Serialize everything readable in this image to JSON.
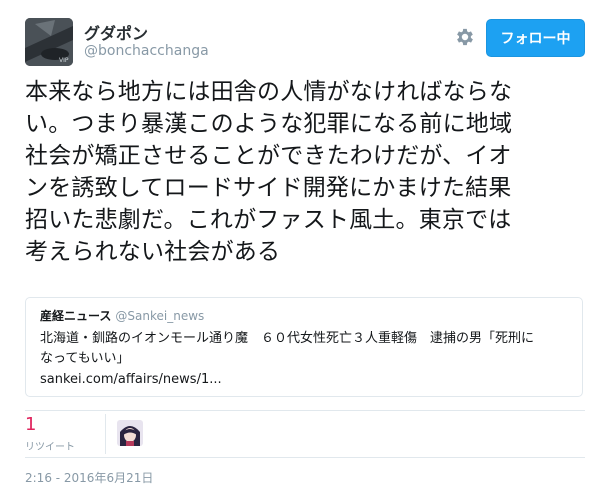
{
  "user": {
    "display_name": "グダポン",
    "screen_name": "@bonchacchanga",
    "avatar_icon": "profile-avatar-image"
  },
  "actions": {
    "gear_icon": "gear-icon",
    "follow_label": "フォロー中"
  },
  "tweet": {
    "lines": [
      "本来なら地方には田舎の人情がなければならな",
      "い。つまり暴漢このような犯罪になる前に地域",
      "社会が矯正させることができたわけだが、イオ",
      "ンを誘致してロードサイド開発にかまけた結果",
      "招いた悲劇だ。これがファスト風土。東京では",
      "考えられない社会がある"
    ]
  },
  "quote": {
    "name": "産経ニュース",
    "handle": "@Sankei_news",
    "lines": [
      "北海道・釧路のイオンモール通り魔　６０代女性死亡３人重軽傷　逮捕の男「死刑に",
      "なってもいい」"
    ],
    "url": "sankei.com/affairs/news/1..."
  },
  "stats": {
    "retweet_count": "1",
    "retweet_label": "リツイート"
  },
  "timestamp": "2:16 - 2016年6月21日",
  "colors": {
    "accent": "#1da1f2",
    "retweet_count": "#e0245e",
    "secondary_text": "#8899a6",
    "border": "#e1e8ed"
  }
}
